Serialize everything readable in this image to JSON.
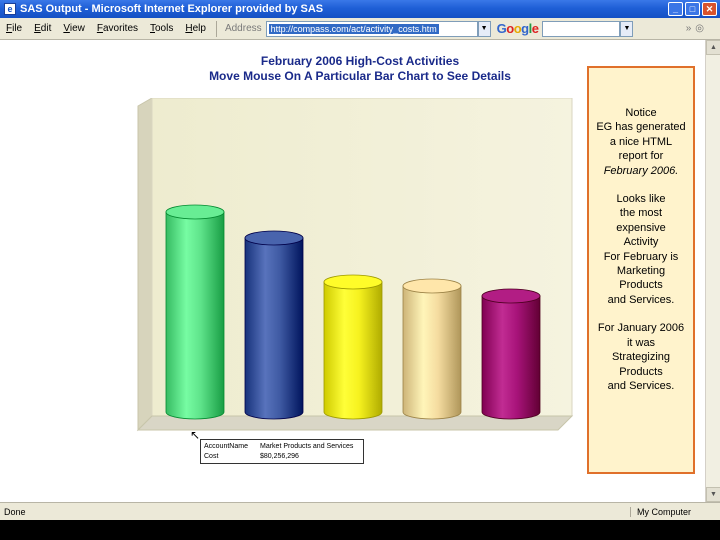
{
  "window": {
    "title": "SAS Output - Microsoft Internet Explorer provided by SAS"
  },
  "menu": [
    "File",
    "Edit",
    "View",
    "Favorites",
    "Tools",
    "Help"
  ],
  "address": {
    "label": "Address",
    "url": "http://compass.com/act/activity_costs.htm"
  },
  "search": {
    "brand_parts": [
      "G",
      "o",
      "o",
      "g",
      "l",
      "e"
    ]
  },
  "chart": {
    "title1": "February 2006 High-Cost Activities",
    "title2": "Move Mouse On A Particular Bar Chart to See Details"
  },
  "chart_data": {
    "type": "bar",
    "categories": [
      "1",
      "2",
      "3",
      "4",
      "5"
    ],
    "values": [
      100,
      87,
      65,
      63,
      58
    ],
    "colors": [
      "#5ee38a",
      "#3f5aa3",
      "#f6f21f",
      "#f5dca0",
      "#a8137a"
    ],
    "ylim": [
      0,
      100
    ],
    "grid": false,
    "legend": "none"
  },
  "tooltip": {
    "rows": [
      {
        "key": "AccountName",
        "value": "Market Products and Services"
      },
      {
        "key": "Cost",
        "value": "$80,256,296"
      }
    ]
  },
  "note": {
    "p1": [
      "Notice",
      "EG has generated",
      "a nice HTML",
      "report for"
    ],
    "p1_italic": "February 2006.",
    "p2": [
      "Looks like",
      "the most",
      "expensive",
      "Activity",
      "For February is",
      "Marketing",
      "Products",
      "and Services."
    ],
    "p3": [
      "For January 2006",
      "it was",
      "Strategizing",
      "Products",
      "and Services."
    ]
  },
  "status": {
    "left": "Done",
    "zone": "My Computer"
  }
}
